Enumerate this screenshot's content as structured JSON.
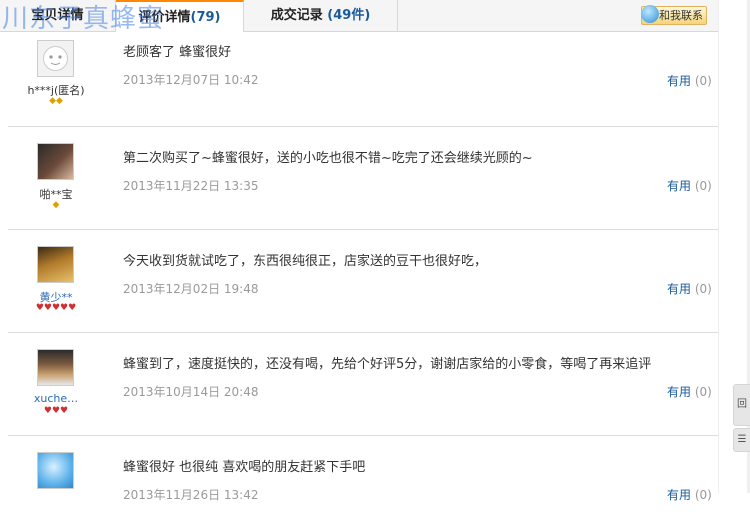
{
  "watermark": "川东子真蜂蜜",
  "tabs": [
    {
      "label": "宝贝详情"
    },
    {
      "label": "评价详情",
      "count": "(79)"
    },
    {
      "label": "成交记录",
      "count": "(49件)"
    }
  ],
  "contact_label": "和我联系",
  "reviews": [
    {
      "user": "h***j(匿名)",
      "text": "老顾客了 蜂蜜很好",
      "date": "2013年12月07日 10:42",
      "useful": "有用",
      "useful_count": "(0)",
      "badges": "◆◆"
    },
    {
      "user": "啪**宝",
      "text": "第二次购买了~蜂蜜很好，送的小吃也很不错~吃完了还会继续光顾的~",
      "date": "2013年11月22日 13:35",
      "useful": "有用",
      "useful_count": "(0)",
      "badges": "◆"
    },
    {
      "user": "黄少**",
      "text": "今天收到货就试吃了，东西很纯很正，店家送的豆干也很好吃，",
      "date": "2013年12月02日 19:48",
      "useful": "有用",
      "useful_count": "(0)",
      "badges": "♥♥♥♥♥"
    },
    {
      "user": "xuche…",
      "text": "蜂蜜到了，速度挺快的，还没有喝，先给个好评5分，谢谢店家给的小零食，等喝了再来追评",
      "date": "2013年10月14日 20:48",
      "useful": "有用",
      "useful_count": "(0)",
      "badges": "♥♥♥"
    },
    {
      "user": "",
      "text": "蜂蜜很好 也很纯 喜欢喝的朋友赶紧下手吧",
      "date": "2013年11月26日 13:42",
      "useful": "有用",
      "useful_count": "(0)",
      "badges": ""
    }
  ],
  "side_buttons": [
    "回",
    "☰"
  ]
}
